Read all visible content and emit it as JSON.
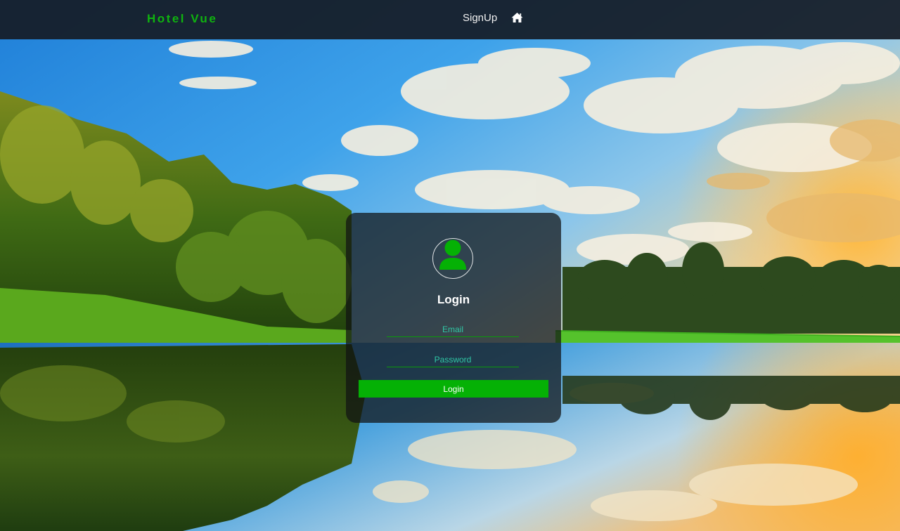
{
  "navbar": {
    "brand": "Hotel Vue",
    "signup_label": "SignUp",
    "home_icon": "home-icon"
  },
  "login_card": {
    "avatar_icon": "user-icon",
    "title": "Login",
    "email_placeholder": "Email",
    "password_placeholder": "Password",
    "login_button_label": "Login"
  },
  "colors": {
    "brand_green": "#0fb30f",
    "button_green": "#05b105",
    "placeholder_teal": "#2fc7a5",
    "navbar_bg": "#161c26"
  }
}
